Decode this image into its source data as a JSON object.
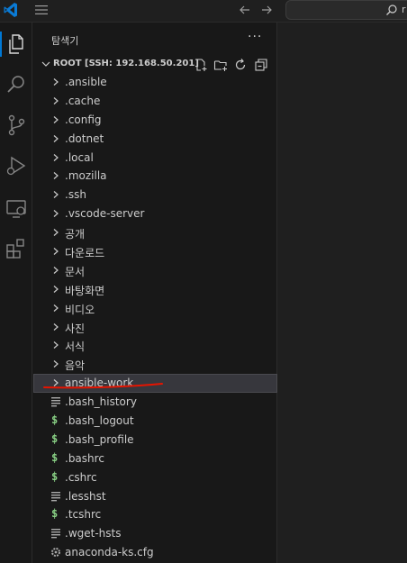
{
  "titlebar": {
    "search_text": "r"
  },
  "sidebar": {
    "title": "탐색기",
    "more_label": "···",
    "root_label": "ROOT [SSH: 192.168.50.201]",
    "items": [
      {
        "label": ".ansible",
        "kind": "folder"
      },
      {
        "label": ".cache",
        "kind": "folder"
      },
      {
        "label": ".config",
        "kind": "folder"
      },
      {
        "label": ".dotnet",
        "kind": "folder"
      },
      {
        "label": ".local",
        "kind": "folder"
      },
      {
        "label": ".mozilla",
        "kind": "folder"
      },
      {
        "label": ".ssh",
        "kind": "folder"
      },
      {
        "label": ".vscode-server",
        "kind": "folder"
      },
      {
        "label": "공개",
        "kind": "folder"
      },
      {
        "label": "다운로드",
        "kind": "folder"
      },
      {
        "label": "문서",
        "kind": "folder"
      },
      {
        "label": "바탕화면",
        "kind": "folder"
      },
      {
        "label": "비디오",
        "kind": "folder"
      },
      {
        "label": "사진",
        "kind": "folder"
      },
      {
        "label": "서식",
        "kind": "folder"
      },
      {
        "label": "음악",
        "kind": "folder"
      },
      {
        "label": "ansible-work",
        "kind": "folder",
        "selected": true
      },
      {
        "label": ".bash_history",
        "kind": "text"
      },
      {
        "label": ".bash_logout",
        "kind": "shell"
      },
      {
        "label": ".bash_profile",
        "kind": "shell"
      },
      {
        "label": ".bashrc",
        "kind": "shell"
      },
      {
        "label": ".cshrc",
        "kind": "shell"
      },
      {
        "label": ".lesshst",
        "kind": "text"
      },
      {
        "label": ".tcshrc",
        "kind": "shell"
      },
      {
        "label": ".wget-hsts",
        "kind": "text"
      },
      {
        "label": "anaconda-ks.cfg",
        "kind": "config"
      }
    ]
  },
  "colors": {
    "accent": "#0078d4",
    "annotation": "#e51400",
    "shell_icon": "#89d185"
  }
}
